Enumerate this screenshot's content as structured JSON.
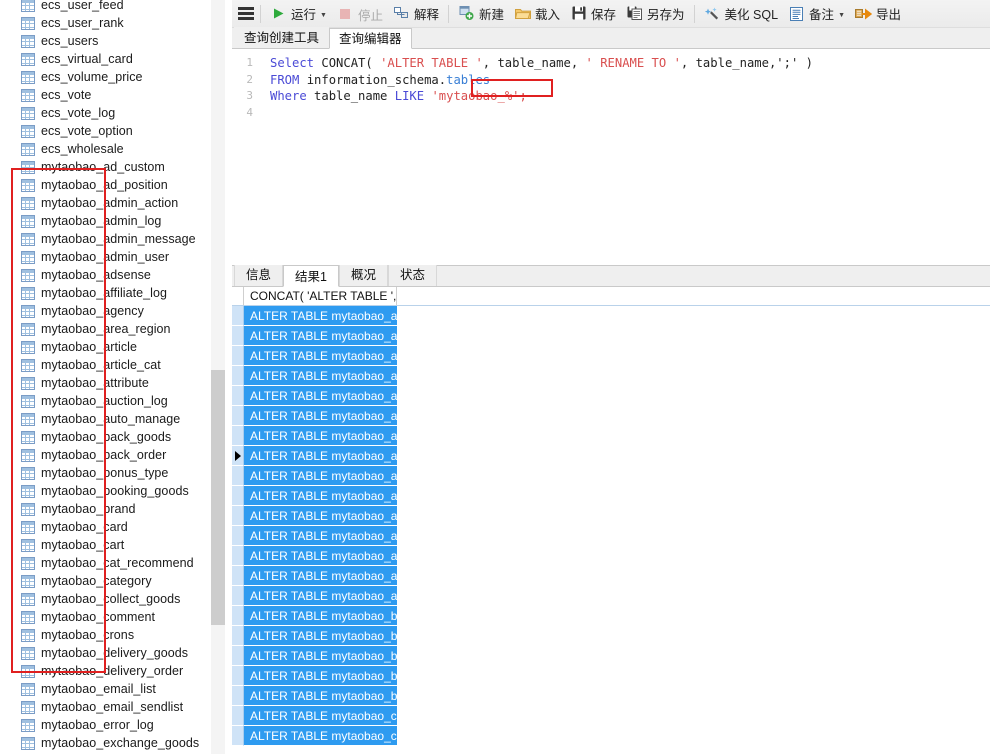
{
  "window": {
    "app": "Navicat SQL Editor"
  },
  "toolbar": {
    "menu_icon": "hamburger-menu-icon",
    "buttons": [
      {
        "label": "运行",
        "icon": "run-play-icon",
        "disabled": false,
        "caret": true
      },
      {
        "label": "停止",
        "icon": "stop-icon",
        "disabled": true,
        "caret": false
      },
      {
        "label": "解释",
        "icon": "explain-icon",
        "disabled": false,
        "caret": false
      },
      {
        "label": "新建",
        "icon": "new-query-icon",
        "disabled": false,
        "caret": false
      },
      {
        "label": "载入",
        "icon": "open-folder-icon",
        "disabled": false,
        "caret": false
      },
      {
        "label": "保存",
        "icon": "save-disk-icon",
        "disabled": false,
        "caret": false
      },
      {
        "label": "另存为",
        "icon": "save-as-icon",
        "disabled": false,
        "caret": false
      },
      {
        "label": "美化 SQL",
        "icon": "beautify-sql-icon",
        "disabled": false,
        "caret": false
      },
      {
        "label": "备注",
        "icon": "comment-icon",
        "disabled": false,
        "caret": true
      },
      {
        "label": "导出",
        "icon": "export-arrow-icon",
        "disabled": false,
        "caret": false
      }
    ]
  },
  "editor_tabs": [
    {
      "label": "查询创建工具",
      "active": false
    },
    {
      "label": "查询编辑器",
      "active": true
    }
  ],
  "code": {
    "line_numbers": [
      "1",
      "2",
      "3",
      "4"
    ],
    "line1": {
      "kw_select": "Select",
      "fn_concat": " CONCAT(",
      "str_alter": " 'ALTER TABLE '",
      "mid": ", table_name,",
      "str_rename": " ' RENAME TO '",
      "tail": ", table_name,';' )"
    },
    "line2": {
      "kw_from": "FROM",
      "schema": " information_schema.",
      "tables": "tables"
    },
    "line3": {
      "kw_where": "Where",
      "col": " table_name ",
      "kw_like": "LIKE",
      "str_pattern": " 'mytaobao_%';"
    },
    "highlight_text": "mytaobao_"
  },
  "result_tabs": [
    {
      "label": "信息",
      "active": false
    },
    {
      "label": "结果1",
      "active": true
    },
    {
      "label": "概况",
      "active": false
    },
    {
      "label": "状态",
      "active": false
    }
  ],
  "grid": {
    "column_header": "CONCAT( 'ALTER TABLE ', t",
    "current_row_index": 7,
    "rows": [
      "ALTER TABLE mytaobao_ad_custom RENAME TO mytaobao_ad_custom;",
      "ALTER TABLE mytaobao_ad_position RENAME TO mytaobao_ad_position;",
      "ALTER TABLE mytaobao_admin_action RENAME TO mytaobao_admin_action;",
      "ALTER TABLE mytaobao_admin_log RENAME TO mytaobao_admin_log;",
      "ALTER TABLE mytaobao_admin_message RENAME TO mytaobao_admin_message;",
      "ALTER TABLE mytaobao_admin_user RENAME TO mytaobao_admin_user;",
      "ALTER TABLE mytaobao_adsense RENAME TO mytaobao_adsense;",
      "ALTER TABLE mytaobao_affiliate_log RENAME TO mytaobao_affiliate_log;",
      "ALTER TABLE mytaobao_agency RENAME TO mytaobao_agency;",
      "ALTER TABLE mytaobao_area_region RENAME TO mytaobao_area_region;",
      "ALTER TABLE mytaobao_article RENAME TO mytaobao_article;",
      "ALTER TABLE mytaobao_article_cat RENAME TO mytaobao_article_cat;",
      "ALTER TABLE mytaobao_attribute RENAME TO mytaobao_attribute;",
      "ALTER TABLE mytaobao_auction_log RENAME TO mytaobao_auction_log;",
      "ALTER TABLE mytaobao_auto_manage RENAME TO mytaobao_auto_manage;",
      "ALTER TABLE mytaobao_back_goods RENAME TO mytaobao_back_goods;",
      "ALTER TABLE mytaobao_back_order RENAME TO mytaobao_back_order;",
      "ALTER TABLE mytaobao_bonus_type RENAME TO mytaobao_bonus_type;",
      "ALTER TABLE mytaobao_booking_goods RENAME TO mytaobao_booking_goods;",
      "ALTER TABLE mytaobao_brand RENAME TO mytaobao_brand;",
      "ALTER TABLE mytaobao_card RENAME TO mytaobao_card;",
      "ALTER TABLE mytaobao_cart RENAME TO mytaobao_cart;"
    ]
  },
  "sidebar": {
    "tree_items": [
      {
        "label": "ecs_user_feed",
        "icon": "table-icon"
      },
      {
        "label": "ecs_user_rank",
        "icon": "table-icon"
      },
      {
        "label": "ecs_users",
        "icon": "table-icon"
      },
      {
        "label": "ecs_virtual_card",
        "icon": "table-icon"
      },
      {
        "label": "ecs_volume_price",
        "icon": "table-icon"
      },
      {
        "label": "ecs_vote",
        "icon": "table-icon"
      },
      {
        "label": "ecs_vote_log",
        "icon": "table-icon"
      },
      {
        "label": "ecs_vote_option",
        "icon": "table-icon"
      },
      {
        "label": "ecs_wholesale",
        "icon": "table-icon"
      },
      {
        "label": "mytaobao_ad_custom",
        "icon": "table-icon"
      },
      {
        "label": "mytaobao_ad_position",
        "icon": "table-icon"
      },
      {
        "label": "mytaobao_admin_action",
        "icon": "table-icon"
      },
      {
        "label": "mytaobao_admin_log",
        "icon": "table-icon"
      },
      {
        "label": "mytaobao_admin_message",
        "icon": "table-icon"
      },
      {
        "label": "mytaobao_admin_user",
        "icon": "table-icon"
      },
      {
        "label": "mytaobao_adsense",
        "icon": "table-icon"
      },
      {
        "label": "mytaobao_affiliate_log",
        "icon": "table-icon"
      },
      {
        "label": "mytaobao_agency",
        "icon": "table-icon"
      },
      {
        "label": "mytaobao_area_region",
        "icon": "table-icon"
      },
      {
        "label": "mytaobao_article",
        "icon": "table-icon"
      },
      {
        "label": "mytaobao_article_cat",
        "icon": "table-icon"
      },
      {
        "label": "mytaobao_attribute",
        "icon": "table-icon"
      },
      {
        "label": "mytaobao_auction_log",
        "icon": "table-icon"
      },
      {
        "label": "mytaobao_auto_manage",
        "icon": "table-icon"
      },
      {
        "label": "mytaobao_back_goods",
        "icon": "table-icon"
      },
      {
        "label": "mytaobao_back_order",
        "icon": "table-icon"
      },
      {
        "label": "mytaobao_bonus_type",
        "icon": "table-icon"
      },
      {
        "label": "mytaobao_booking_goods",
        "icon": "table-icon"
      },
      {
        "label": "mytaobao_brand",
        "icon": "table-icon"
      },
      {
        "label": "mytaobao_card",
        "icon": "table-icon"
      },
      {
        "label": "mytaobao_cart",
        "icon": "table-icon"
      },
      {
        "label": "mytaobao_cat_recommend",
        "icon": "table-icon"
      },
      {
        "label": "mytaobao_category",
        "icon": "table-icon"
      },
      {
        "label": "mytaobao_collect_goods",
        "icon": "table-icon"
      },
      {
        "label": "mytaobao_comment",
        "icon": "table-icon"
      },
      {
        "label": "mytaobao_crons",
        "icon": "table-icon"
      },
      {
        "label": "mytaobao_delivery_goods",
        "icon": "table-icon"
      },
      {
        "label": "mytaobao_delivery_order",
        "icon": "table-icon"
      },
      {
        "label": "mytaobao_email_list",
        "icon": "table-icon"
      },
      {
        "label": "mytaobao_email_sendlist",
        "icon": "table-icon"
      },
      {
        "label": "mytaobao_error_log",
        "icon": "table-icon"
      },
      {
        "label": "mytaobao_exchange_goods",
        "icon": "table-icon"
      }
    ]
  },
  "colors": {
    "annotation_red": "#e02020",
    "selection_blue": "#2e9bf0",
    "row_header_blue": "#cfe3f7",
    "keyword_blue": "#4a4ad6",
    "string_red": "#d94f4f"
  }
}
